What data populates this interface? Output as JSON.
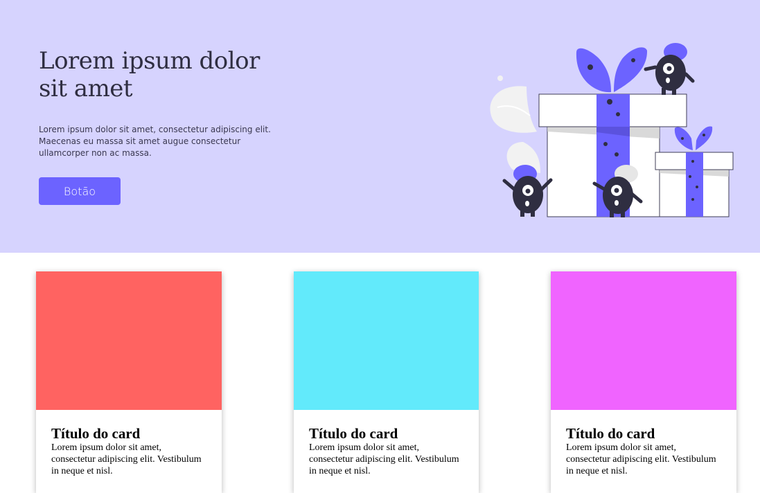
{
  "hero": {
    "title": "Lorem ipsum dolor sit amet",
    "description": "Lorem ipsum dolor sit amet, consectetur adipiscing elit. Maecenas eu massa sit amet augue consectetur ullamcorper non ac massa.",
    "button_label": "Botão",
    "background_color": "#d6d3fe",
    "accent_color": "#6c63ff",
    "illustration": "gift-boxes-monsters-illustration"
  },
  "cards": [
    {
      "title": "Título do card",
      "text": "Lorem ipsum dolor sit amet, consectetur adipiscing elit. Vestibulum in neque et nisl.",
      "image_color": "#ff6361"
    },
    {
      "title": "Título do card",
      "text": "Lorem ipsum dolor sit amet, consectetur adipiscing elit. Vestibulum in neque et nisl.",
      "image_color": "#62eafb"
    },
    {
      "title": "Título do card",
      "text": "Lorem ipsum dolor sit amet, consectetur adipiscing elit. Vestibulum in neque et nisl.",
      "image_color": "#f064ff"
    }
  ]
}
